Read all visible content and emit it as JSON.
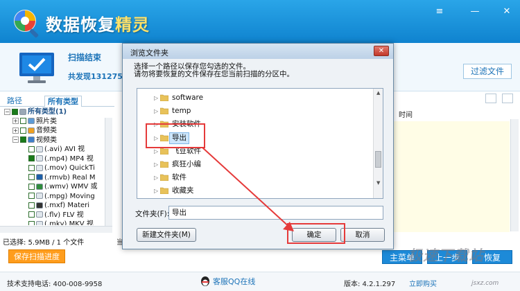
{
  "app": {
    "title_main": "数据恢复",
    "title_accent": "精灵",
    "window_controls": [
      "≡",
      "—",
      "✕"
    ]
  },
  "scan": {
    "status": "扫描结束",
    "found": "共发现131275",
    "filter_button": "过滤文件"
  },
  "tabs": [
    {
      "label": "路径",
      "active": false
    },
    {
      "label": "所有类型",
      "active": true
    }
  ],
  "tree": [
    {
      "exp": "−",
      "checked": true,
      "icon": "drive",
      "label": "所有类型(1)",
      "bold": true,
      "indent": 0
    },
    {
      "exp": "+",
      "checked": false,
      "icon": "image",
      "label": "照片类",
      "bold": false,
      "indent": 1
    },
    {
      "exp": "+",
      "checked": false,
      "icon": "audio",
      "label": "音频类",
      "bold": false,
      "indent": 1
    },
    {
      "exp": "−",
      "checked": true,
      "icon": "video",
      "label": "视频类",
      "bold": false,
      "indent": 1
    },
    {
      "exp": "",
      "checked": false,
      "icon": "file",
      "label": "(.avi) AVI 视",
      "bold": false,
      "indent": 2
    },
    {
      "exp": "",
      "checked": true,
      "icon": "file",
      "label": "(.mp4) MP4 视",
      "bold": false,
      "indent": 2
    },
    {
      "exp": "",
      "checked": false,
      "icon": "file",
      "label": "(.mov) QuickTi",
      "bold": false,
      "indent": 2
    },
    {
      "exp": "",
      "checked": false,
      "icon": "real",
      "label": "(.rmvb) Real M",
      "bold": false,
      "indent": 2
    },
    {
      "exp": "",
      "checked": false,
      "icon": "wmv",
      "label": "(.wmv) WMV 或",
      "bold": false,
      "indent": 2
    },
    {
      "exp": "",
      "checked": false,
      "icon": "file",
      "label": "(.mpg) Moving",
      "bold": false,
      "indent": 2
    },
    {
      "exp": "",
      "checked": false,
      "icon": "mxf",
      "label": "(.mxf) Materi",
      "bold": false,
      "indent": 2
    },
    {
      "exp": "",
      "checked": false,
      "icon": "file",
      "label": "(.flv) FLV 视",
      "bold": false,
      "indent": 2
    },
    {
      "exp": "",
      "checked": false,
      "icon": "file",
      "label": "(.mkv) MKV 视",
      "bold": false,
      "indent": 2
    }
  ],
  "list": {
    "column_time": "时间"
  },
  "status_bar": {
    "selected": "已选择: 5.9MB / 1 个文件",
    "current": "当"
  },
  "buttons": {
    "save_progress": "保存扫描进度",
    "main_menu": "主菜单",
    "prev_step": "上一步",
    "recover": "恢复"
  },
  "footer": {
    "phone": "技术支持电话: 400-008-9958",
    "qq": "客服QQ在线",
    "version": "版本: 4.2.1.297",
    "buy": "立即购买"
  },
  "watermark": {
    "text": "极速下载站",
    "url": "jsxz.com"
  },
  "dialog": {
    "title": "浏览文件夹",
    "close": "✕",
    "instruction_1": "选择一个路径以保存您勾选的文件。",
    "instruction_2": "请勿将要恢复的文件保存在您当前扫描的分区中。",
    "folders": [
      {
        "label": "software",
        "selected": false
      },
      {
        "label": "temp",
        "selected": false
      },
      {
        "label": "安装软件",
        "selected": false
      },
      {
        "label": "导出",
        "selected": true
      },
      {
        "label": "飞豆软件",
        "selected": false
      },
      {
        "label": "疯狂小编",
        "selected": false
      },
      {
        "label": "软件",
        "selected": false
      },
      {
        "label": "收藏夹",
        "selected": false
      }
    ],
    "folder_label": "文件夹(F):",
    "folder_value": "导出",
    "new_folder_button": "新建文件夹(M)",
    "ok_button": "确定",
    "cancel_button": "取消"
  },
  "colors": {
    "header_blue": "#1a93dd",
    "title_accent": "#ffe26a",
    "orange": "#ff9d1d",
    "action_blue": "#1d8ad8",
    "annotation_red": "#e53a3a"
  }
}
